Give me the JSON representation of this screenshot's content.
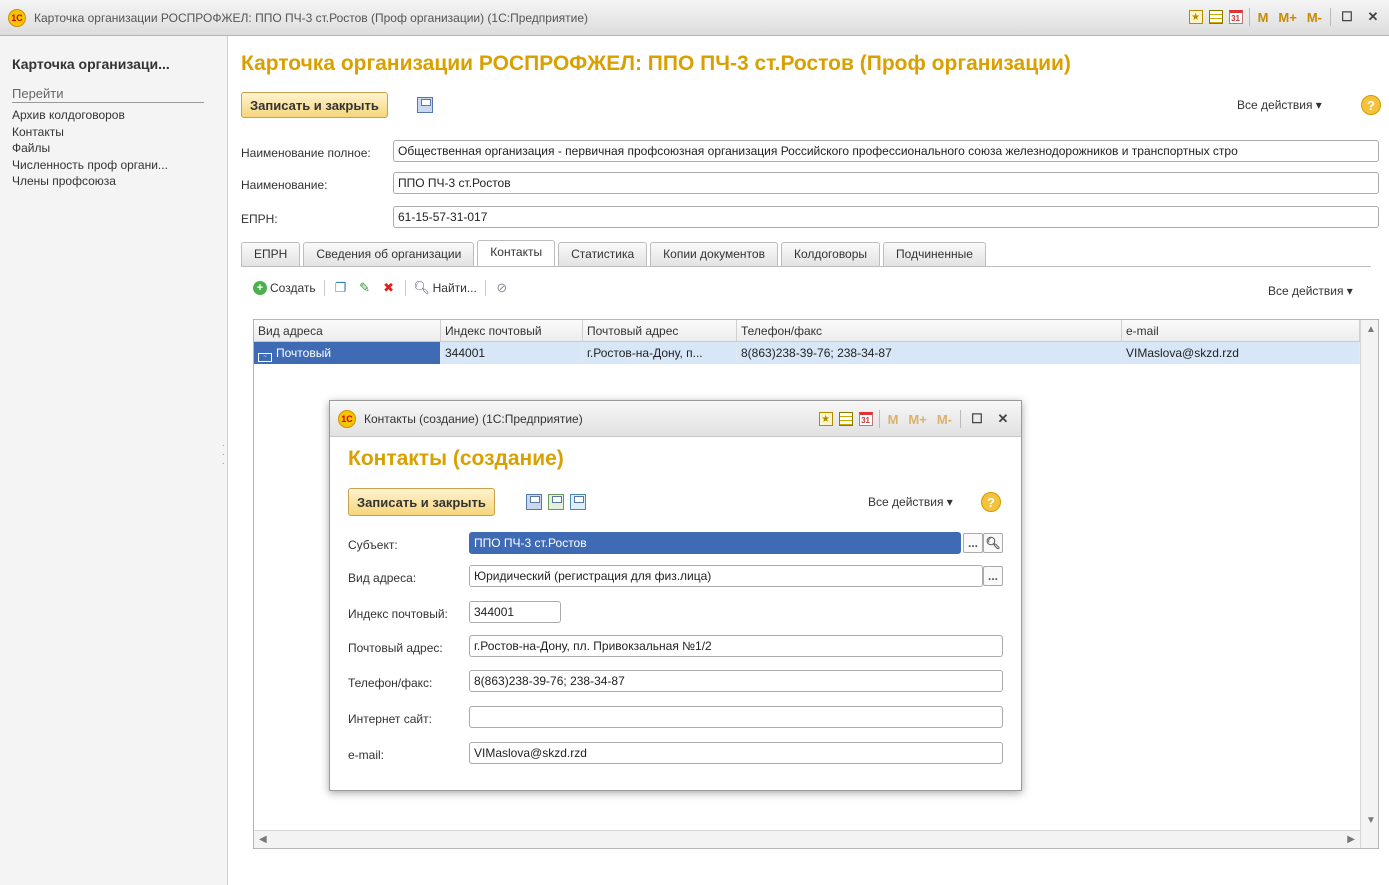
{
  "window": {
    "title": "Карточка организации РОСПРОФЖЕЛ: ППО ПЧ-3 ст.Ростов (Проф организации)  (1С:Предприятие)",
    "logo": "1С",
    "memory_buttons": [
      "M",
      "M+",
      "M-"
    ]
  },
  "sidebar": {
    "title": "Карточка организаци...",
    "goto_label": "Перейти",
    "items": [
      {
        "label": "Архив колдоговоров"
      },
      {
        "label": "Контакты"
      },
      {
        "label": "Файлы"
      },
      {
        "label": "Численность проф органи..."
      },
      {
        "label": "Члены профсоюза"
      }
    ]
  },
  "form": {
    "title": "Карточка организации РОСПРОФЖЕЛ: ППО ПЧ-3 ст.Ростов (Проф организации)",
    "save_close_label": "Записать и закрыть",
    "all_actions_label": "Все действия ▾",
    "help_label": "?",
    "fields": {
      "full_name_label": "Наименование полное:",
      "full_name_value": "Общественная организация - первичная профсоюзная организация Российского профессионального союза железнодорожников и транспортных стро",
      "name_label": "Наименование:",
      "name_value": "ППО ПЧ-3 ст.Ростов",
      "eprn_label": "ЕПРН:",
      "eprn_value": "61-15-57-31-017"
    },
    "tabs": [
      {
        "label": "ЕПРН",
        "active": false
      },
      {
        "label": "Сведения об организации",
        "active": false
      },
      {
        "label": "Контакты",
        "active": true
      },
      {
        "label": "Статистика",
        "active": false
      },
      {
        "label": "Копии документов",
        "active": false
      },
      {
        "label": "Колдоговоры",
        "active": false
      },
      {
        "label": "Подчиненные",
        "active": false
      }
    ],
    "contacts_toolbar": {
      "create_label": "Создать",
      "find_label": "Найти...",
      "all_actions_label": "Все действия ▾"
    },
    "contacts_table": {
      "columns": [
        "Вид адреса",
        "Индекс почтовый",
        "Почтовый адрес",
        "Телефон/факс",
        "e-mail"
      ],
      "rows": [
        {
          "type": "Почтовый",
          "index": "344001",
          "address": "г.Ростов-на-Дону, п...",
          "phone": "8(863)238-39-76; 238-34-87",
          "email": "VIMaslova@skzd.rzd"
        }
      ]
    }
  },
  "dialog": {
    "window_title": "Контакты (создание)  (1С:Предприятие)",
    "title": "Контакты (создание)",
    "save_close_label": "Записать и закрыть",
    "all_actions_label": "Все действия ▾",
    "help_label": "?",
    "fields": {
      "subject_label": "Субъект:",
      "subject_value": "ППО ПЧ-3 ст.Ростов",
      "address_type_label": "Вид адреса:",
      "address_type_value": "Юридический (регистрация для физ.лица)",
      "index_label": "Индекс почтовый:",
      "index_value": "344001",
      "address_label": "Почтовый адрес:",
      "address_value": "г.Ростов-на-Дону, пл. Привокзальная №1/2",
      "phone_label": "Телефон/факс:",
      "phone_value": "8(863)238-39-76; 238-34-87",
      "site_label": "Интернет сайт:",
      "site_value": "",
      "email_label": "e-mail:",
      "email_value": "VIMaslova@skzd.rzd"
    }
  },
  "colors": {
    "accent": "#d9a000",
    "selection": "#3f6bb5",
    "row_highlight": "#d7e7f7"
  }
}
